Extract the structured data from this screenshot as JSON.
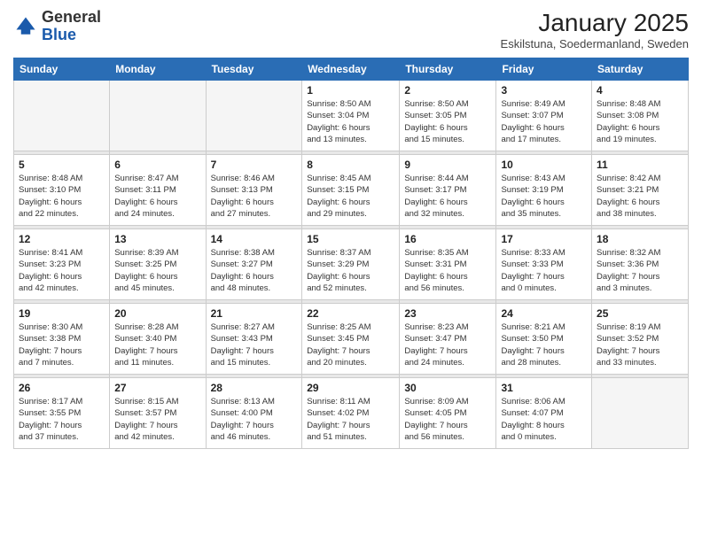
{
  "header": {
    "logo_general": "General",
    "logo_blue": "Blue",
    "month_year": "January 2025",
    "location": "Eskilstuna, Soedermanland, Sweden"
  },
  "days_of_week": [
    "Sunday",
    "Monday",
    "Tuesday",
    "Wednesday",
    "Thursday",
    "Friday",
    "Saturday"
  ],
  "weeks": [
    {
      "days": [
        {
          "num": "",
          "info": ""
        },
        {
          "num": "",
          "info": ""
        },
        {
          "num": "",
          "info": ""
        },
        {
          "num": "1",
          "info": "Sunrise: 8:50 AM\nSunset: 3:04 PM\nDaylight: 6 hours\nand 13 minutes."
        },
        {
          "num": "2",
          "info": "Sunrise: 8:50 AM\nSunset: 3:05 PM\nDaylight: 6 hours\nand 15 minutes."
        },
        {
          "num": "3",
          "info": "Sunrise: 8:49 AM\nSunset: 3:07 PM\nDaylight: 6 hours\nand 17 minutes."
        },
        {
          "num": "4",
          "info": "Sunrise: 8:48 AM\nSunset: 3:08 PM\nDaylight: 6 hours\nand 19 minutes."
        }
      ]
    },
    {
      "days": [
        {
          "num": "5",
          "info": "Sunrise: 8:48 AM\nSunset: 3:10 PM\nDaylight: 6 hours\nand 22 minutes."
        },
        {
          "num": "6",
          "info": "Sunrise: 8:47 AM\nSunset: 3:11 PM\nDaylight: 6 hours\nand 24 minutes."
        },
        {
          "num": "7",
          "info": "Sunrise: 8:46 AM\nSunset: 3:13 PM\nDaylight: 6 hours\nand 27 minutes."
        },
        {
          "num": "8",
          "info": "Sunrise: 8:45 AM\nSunset: 3:15 PM\nDaylight: 6 hours\nand 29 minutes."
        },
        {
          "num": "9",
          "info": "Sunrise: 8:44 AM\nSunset: 3:17 PM\nDaylight: 6 hours\nand 32 minutes."
        },
        {
          "num": "10",
          "info": "Sunrise: 8:43 AM\nSunset: 3:19 PM\nDaylight: 6 hours\nand 35 minutes."
        },
        {
          "num": "11",
          "info": "Sunrise: 8:42 AM\nSunset: 3:21 PM\nDaylight: 6 hours\nand 38 minutes."
        }
      ]
    },
    {
      "days": [
        {
          "num": "12",
          "info": "Sunrise: 8:41 AM\nSunset: 3:23 PM\nDaylight: 6 hours\nand 42 minutes."
        },
        {
          "num": "13",
          "info": "Sunrise: 8:39 AM\nSunset: 3:25 PM\nDaylight: 6 hours\nand 45 minutes."
        },
        {
          "num": "14",
          "info": "Sunrise: 8:38 AM\nSunset: 3:27 PM\nDaylight: 6 hours\nand 48 minutes."
        },
        {
          "num": "15",
          "info": "Sunrise: 8:37 AM\nSunset: 3:29 PM\nDaylight: 6 hours\nand 52 minutes."
        },
        {
          "num": "16",
          "info": "Sunrise: 8:35 AM\nSunset: 3:31 PM\nDaylight: 6 hours\nand 56 minutes."
        },
        {
          "num": "17",
          "info": "Sunrise: 8:33 AM\nSunset: 3:33 PM\nDaylight: 7 hours\nand 0 minutes."
        },
        {
          "num": "18",
          "info": "Sunrise: 8:32 AM\nSunset: 3:36 PM\nDaylight: 7 hours\nand 3 minutes."
        }
      ]
    },
    {
      "days": [
        {
          "num": "19",
          "info": "Sunrise: 8:30 AM\nSunset: 3:38 PM\nDaylight: 7 hours\nand 7 minutes."
        },
        {
          "num": "20",
          "info": "Sunrise: 8:28 AM\nSunset: 3:40 PM\nDaylight: 7 hours\nand 11 minutes."
        },
        {
          "num": "21",
          "info": "Sunrise: 8:27 AM\nSunset: 3:43 PM\nDaylight: 7 hours\nand 15 minutes."
        },
        {
          "num": "22",
          "info": "Sunrise: 8:25 AM\nSunset: 3:45 PM\nDaylight: 7 hours\nand 20 minutes."
        },
        {
          "num": "23",
          "info": "Sunrise: 8:23 AM\nSunset: 3:47 PM\nDaylight: 7 hours\nand 24 minutes."
        },
        {
          "num": "24",
          "info": "Sunrise: 8:21 AM\nSunset: 3:50 PM\nDaylight: 7 hours\nand 28 minutes."
        },
        {
          "num": "25",
          "info": "Sunrise: 8:19 AM\nSunset: 3:52 PM\nDaylight: 7 hours\nand 33 minutes."
        }
      ]
    },
    {
      "days": [
        {
          "num": "26",
          "info": "Sunrise: 8:17 AM\nSunset: 3:55 PM\nDaylight: 7 hours\nand 37 minutes."
        },
        {
          "num": "27",
          "info": "Sunrise: 8:15 AM\nSunset: 3:57 PM\nDaylight: 7 hours\nand 42 minutes."
        },
        {
          "num": "28",
          "info": "Sunrise: 8:13 AM\nSunset: 4:00 PM\nDaylight: 7 hours\nand 46 minutes."
        },
        {
          "num": "29",
          "info": "Sunrise: 8:11 AM\nSunset: 4:02 PM\nDaylight: 7 hours\nand 51 minutes."
        },
        {
          "num": "30",
          "info": "Sunrise: 8:09 AM\nSunset: 4:05 PM\nDaylight: 7 hours\nand 56 minutes."
        },
        {
          "num": "31",
          "info": "Sunrise: 8:06 AM\nSunset: 4:07 PM\nDaylight: 8 hours\nand 0 minutes."
        },
        {
          "num": "",
          "info": ""
        }
      ]
    }
  ]
}
